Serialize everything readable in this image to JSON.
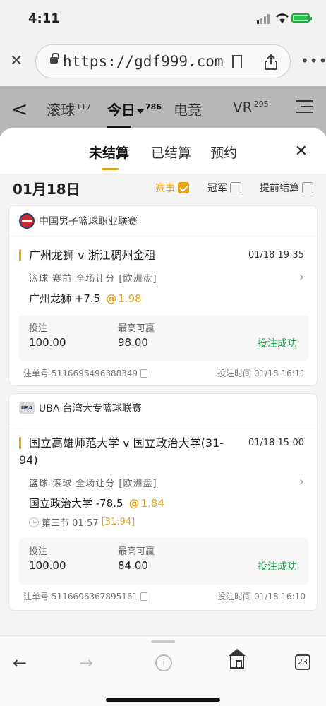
{
  "status": {
    "time": "4:11"
  },
  "browser": {
    "url": "https://gdf999.com",
    "tabs_count": "23"
  },
  "nav": {
    "tabs": [
      {
        "label": "滚球",
        "count": "117"
      },
      {
        "label": "今日",
        "count": "786"
      },
      {
        "label": "电竞",
        "count": ""
      },
      {
        "label": "VR",
        "count": "295"
      }
    ]
  },
  "sheet": {
    "subtabs": [
      "未结算",
      "已结算",
      "预约"
    ],
    "date": "01月18日",
    "filters": [
      {
        "label": "赛事",
        "checked": true
      },
      {
        "label": "冠军",
        "checked": false
      },
      {
        "label": "提前结算",
        "checked": false
      }
    ]
  },
  "bets": [
    {
      "league": "中国男子篮球职业联赛",
      "match": "广州龙狮 v 浙江稠州金租",
      "match_time": "01/18 19:35",
      "meta": "篮球  赛前  全场让分  [欧洲盘]",
      "pick": "广州龙狮 +7.5",
      "odds": "1.98",
      "period": "",
      "live_score": "",
      "stake_label": "投注",
      "stake": "100.00",
      "win_label": "最高可赢",
      "win": "98.00",
      "status": "投注成功",
      "order_label": "注单号",
      "order_no": "5116696496388349",
      "bet_time_label": "投注时间",
      "bet_time": "01/18 16:11"
    },
    {
      "league": "UBA 台湾大专篮球联赛",
      "match_line1": "国立高雄师范大学 v 国立政治大学(31-",
      "match_line2": "94)",
      "match_time": "01/18 15:00",
      "meta": "篮球  滚球  全场让分  [欧洲盘]",
      "pick": "国立政治大学 -78.5",
      "odds": "1.84",
      "period": "第三节  01:57",
      "live_score": "[31:94]",
      "stake_label": "投注",
      "stake": "100.00",
      "win_label": "最高可赢",
      "win": "84.00",
      "status": "投注成功",
      "order_label": "注单号",
      "order_no": "5116696367895161",
      "bet_time_label": "投注时间",
      "bet_time": "01/18 16:10"
    }
  ]
}
